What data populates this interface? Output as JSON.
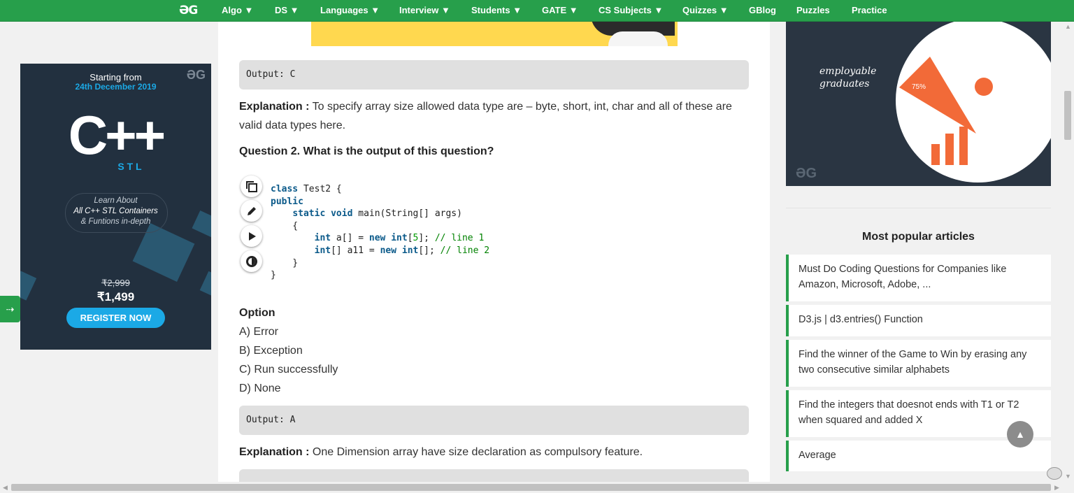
{
  "nav": {
    "logo": "ƏG",
    "items": [
      "Algo ▼",
      "DS ▼",
      "Languages ▼",
      "Interview ▼",
      "Students ▼",
      "GATE ▼",
      "CS Subjects ▼",
      "Quizzes ▼",
      "GBlog",
      "Puzzles",
      "Practice"
    ]
  },
  "left_ad": {
    "brand": "ƏG",
    "starting": "Starting from",
    "date": "24th December 2019",
    "cpp": "C++",
    "stl": "S T L",
    "learn1": "Learn About",
    "learn2": "All C++ STL Containers",
    "learn3": "& Funtions in-depth",
    "old_price": "₹2,999",
    "new_price": "₹1,499",
    "register": "REGISTER NOW"
  },
  "side_tab": "⇢",
  "content": {
    "output1": "Output: C",
    "expl1_label": "Explanation :",
    "expl1_text": " To specify array size allowed data type are – byte, short, int, char and all of these are valid data types here.",
    "question2": "Question 2. What is the output of this question?",
    "code_controls": [
      "copy-icon",
      "edit-icon",
      "run-icon",
      "theme-icon"
    ],
    "option_heading": "Option",
    "options": [
      "A) Error",
      "B) Exception",
      "C) Run successfully",
      "D) None"
    ],
    "output2": "Output: A",
    "expl2_label": "Explanation :",
    "expl2_text": " One Dimension array have size declaration as compulsory feature."
  },
  "right_ad": {
    "line1": "employable",
    "line2": "graduates",
    "pct": "75%",
    "logo": "ƏG"
  },
  "popular": {
    "title": "Most popular articles",
    "items": [
      "Must Do Coding Questions for Companies like Amazon, Microsoft, Adobe, ...",
      "D3.js | d3.entries() Function",
      "Find the winner of the Game to Win by erasing any two consecutive similar alphabets",
      "Find the integers that doesnot ends with T1 or T2 when squared and added X",
      "Average"
    ]
  },
  "scroll_top": "▲"
}
